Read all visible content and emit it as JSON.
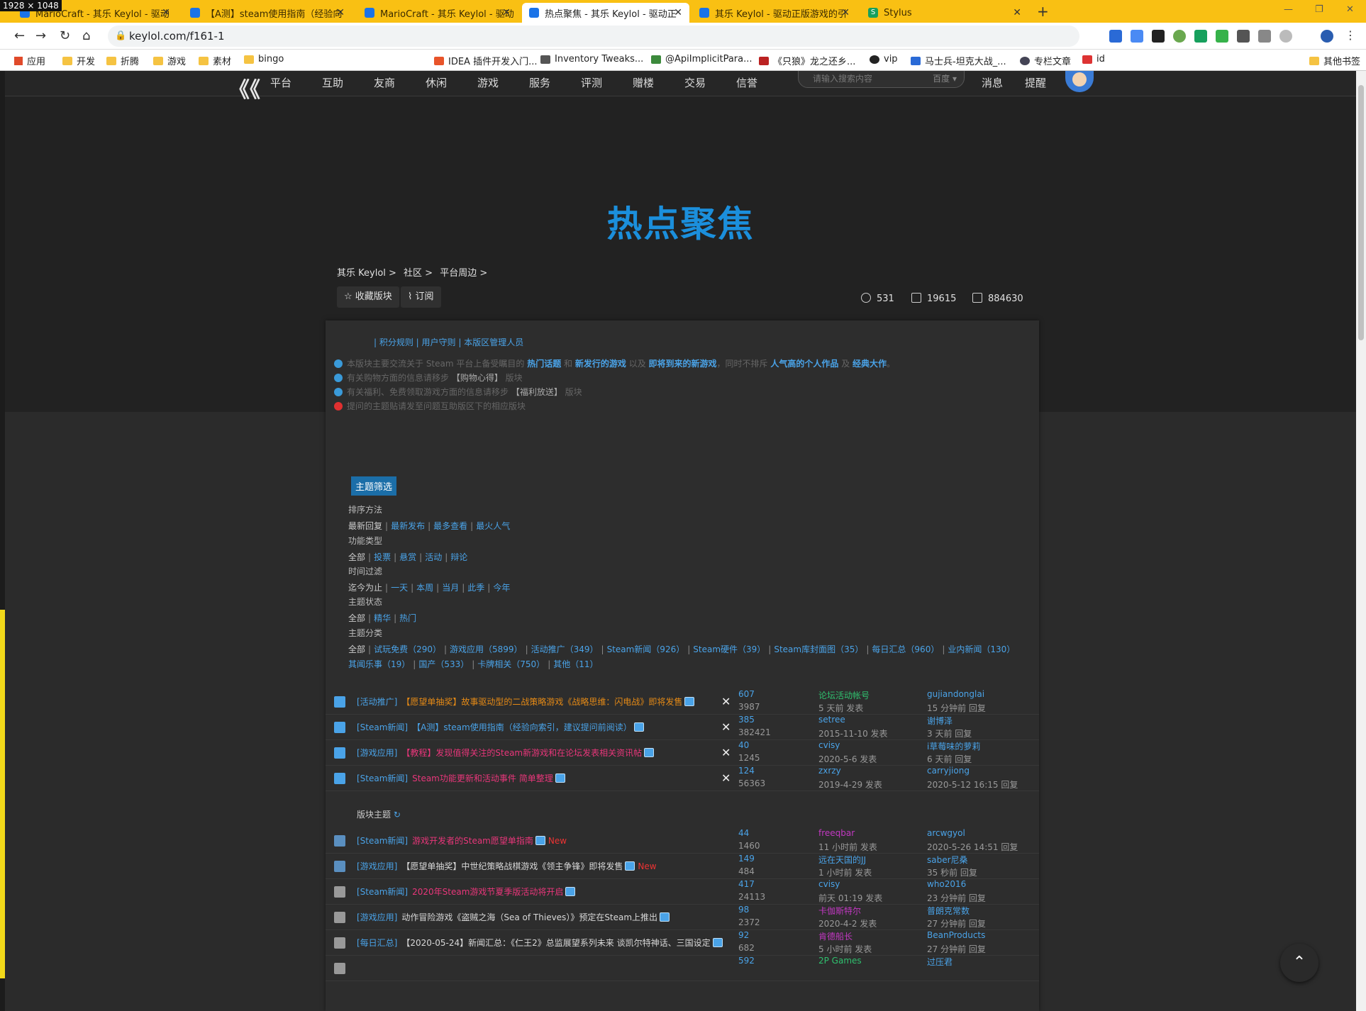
{
  "window": {
    "dims_label": "1928 × 1048"
  },
  "tabs": [
    {
      "label": "MarioCraft - 其乐 Keylol - 驱动",
      "active": false
    },
    {
      "label": "【A测】steam使用指南（经验向",
      "active": false
    },
    {
      "label": "MarioCraft - 其乐 Keylol - 驱动",
      "active": false
    },
    {
      "label": "热点聚焦 - 其乐 Keylol - 驱动正",
      "active": true
    },
    {
      "label": "其乐 Keylol - 驱动正版游戏的引",
      "active": false
    },
    {
      "label": "Stylus",
      "active": false
    }
  ],
  "address": {
    "url": "keylol.com/f161-1"
  },
  "bookmarks": [
    "应用",
    "开发",
    "折腾",
    "游戏",
    "素材",
    "bingo",
    "IDEA 插件开发入门...",
    "Inventory Tweaks...",
    "@ApiImplicitPara...",
    "《只狼》龙之还乡...",
    "vip",
    "马士兵-坦克大战_...",
    "专栏文章",
    "id",
    "其他书签"
  ],
  "nav": {
    "items": [
      "平台",
      "互助",
      "友商",
      "休闲",
      "游戏",
      "服务",
      "评测",
      "赠楼",
      "交易",
      "信誉"
    ],
    "search_placeholder": "请输入搜索内容",
    "search_engine": "百度 ▾",
    "messages": "消息",
    "alerts": "提醒"
  },
  "forum": {
    "title": "热点聚焦",
    "breadcrumb": [
      "其乐 Keylol >",
      "社区 >",
      "平台周边 >"
    ],
    "fav_button": "收藏版块",
    "rss_button": "订阅",
    "stats": {
      "today": "531",
      "threads": "19615",
      "posts": "884630"
    },
    "rules_links": "| 积分规则 | 用户守则 | 本版区管理人员",
    "notices": [
      {
        "pre": "本版块主要交流关于 Steam 平台上备受瞩目的 ",
        "h1": "热门话题",
        "m1": " 和 ",
        "h2": "新发行的游戏",
        "m2": " 以及 ",
        "h3": "即将到来的新游戏",
        "m3": "，同时不排斥 ",
        "h4": "人气高的个人作品",
        "m4": " 及 ",
        "h5": "经典大作",
        "post": "。"
      },
      {
        "pre": "有关购物方面的信息请移步 ",
        "wt": "【购物心得】",
        "post": " 版块"
      },
      {
        "pre": "有关福利、免费领取游戏方面的信息请移步 ",
        "wt": "【福利放送】",
        "post": " 版块"
      },
      {
        "pre": "提问的主题贴请发至问题互助版区下的相应版块",
        "wt": "",
        "post": ""
      }
    ],
    "filter_tag": "主题筛选",
    "filters": [
      {
        "head": "排序方法",
        "first": "最新回复",
        "links": [
          "最新发布",
          "最多查看",
          "最火人气"
        ]
      },
      {
        "head": "功能类型",
        "first": "全部",
        "links": [
          "投票",
          "悬赏",
          "活动",
          "辩论"
        ]
      },
      {
        "head": "时间过滤",
        "first": "迄今为止",
        "links": [
          "一天",
          "本周",
          "当月",
          "此季",
          "今年"
        ]
      },
      {
        "head": "主题状态",
        "first": "全部",
        "links": [
          "精华",
          "热门"
        ]
      }
    ],
    "categories_head": "主题分类",
    "categories_line1": [
      "全部",
      "试玩免费（290）",
      "游戏应用（5899）",
      "活动推广（349）",
      "Steam新闻（926）",
      "Steam硬件（39）",
      "Steam库封面图（35）",
      "每日汇总（960）",
      "业内新闻（130）"
    ],
    "categories_line2": [
      "其闻乐事（19）",
      "国产（533）",
      "卡牌相关（750）",
      "其他（11）"
    ],
    "section_label": "版块主题",
    "pinned": [
      {
        "cat": "[活动推广]",
        "title": "【愿望单抽奖】故事驱动型的二战策略游戏《战略思维：闪电战》即将发售",
        "color": "orange",
        "replies": "607",
        "views": "3987",
        "author": "论坛活动帐号",
        "author_color": "green",
        "posted": "5 天前 发表",
        "last": "gujiandonglai",
        "last_time": "15 分钟前 回复"
      },
      {
        "cat": "[Steam新闻]",
        "title": "【A测】steam使用指南（经验向索引，建议提问前阅读）",
        "color": "blue",
        "replies": "385",
        "views": "382421",
        "author": "setree",
        "author_color": "blue",
        "posted": "2015-11-10 发表",
        "last": "谢博泽",
        "last_time": "3 天前 回复"
      },
      {
        "cat": "[游戏应用]",
        "title": "【教程】发现值得关注的Steam新游戏和在论坛发表相关资讯帖",
        "color": "pink",
        "replies": "40",
        "views": "1245",
        "author": "cvisy",
        "author_color": "blue",
        "posted": "2020-5-6 发表",
        "last": "i草莓味的萝莉",
        "last_time": "6 天前 回复"
      },
      {
        "cat": "[Steam新闻]",
        "title": "Steam功能更新和活动事件 简单整理",
        "color": "pink",
        "replies": "124",
        "views": "56363",
        "author": "zxrzy",
        "author_color": "blue",
        "posted": "2019-4-29 发表",
        "last": "carryjiong",
        "last_time": "2020-5-12 16:15 回复"
      }
    ],
    "threads": [
      {
        "cat": "[Steam新闻]",
        "title": "游戏开发者的Steam愿望单指南",
        "color": "pink",
        "new": "New",
        "replies": "44",
        "views": "1460",
        "author": "freeqbar",
        "author_color": "purple",
        "posted": "11 小时前 发表",
        "last": "arcwgyol",
        "last_time": "2020-5-26 14:51 回复"
      },
      {
        "cat": "[游戏应用]",
        "title": "【愿望单抽奖】中世纪策略战棋游戏《领主争锋》即将发售",
        "color": "white",
        "new": "New",
        "replies": "149",
        "views": "484",
        "author": "远在天国的JJ",
        "author_color": "blue",
        "posted": "1 小时前 发表",
        "last": "saber尼桑",
        "last_time": "35 秒前 回复"
      },
      {
        "cat": "[Steam新闻]",
        "title": "2020年Steam游戏节夏季版活动将开启",
        "color": "pink",
        "new": "",
        "replies": "417",
        "views": "24113",
        "author": "cvisy",
        "author_color": "blue",
        "posted": "前天 01:19 发表",
        "last": "who2016",
        "last_time": "23 分钟前 回复"
      },
      {
        "cat": "[游戏应用]",
        "title": "动作冒险游戏《盗贼之海（Sea of Thieves）》预定在Steam上推出",
        "color": "white",
        "new": "",
        "replies": "98",
        "views": "2372",
        "author": "卡伽斯特尔",
        "author_color": "purple",
        "posted": "2020-4-2 发表",
        "last": "普朗克常数",
        "last_time": "27 分钟前 回复"
      },
      {
        "cat": "[每日汇总]",
        "title": "【2020-05-24】新闻汇总：《仁王2》总监展望系列未来 谈凯尔特神话、三国设定",
        "color": "white",
        "new": "",
        "replies": "92",
        "views": "682",
        "author": "肯德船长",
        "author_color": "purple",
        "posted": "5 小时前 发表",
        "last": "BeanProducts",
        "last_time": "27 分钟前 回复"
      },
      {
        "cat": "",
        "title": "",
        "color": "white",
        "new": "",
        "replies": "592",
        "views": "",
        "author": "2P Games",
        "author_color": "green",
        "posted": "",
        "last": "过压君",
        "last_time": ""
      }
    ]
  },
  "colors": {
    "accent": "#1b8fdc",
    "tabbar": "#f9c013",
    "bg": "#2b2b2b"
  }
}
